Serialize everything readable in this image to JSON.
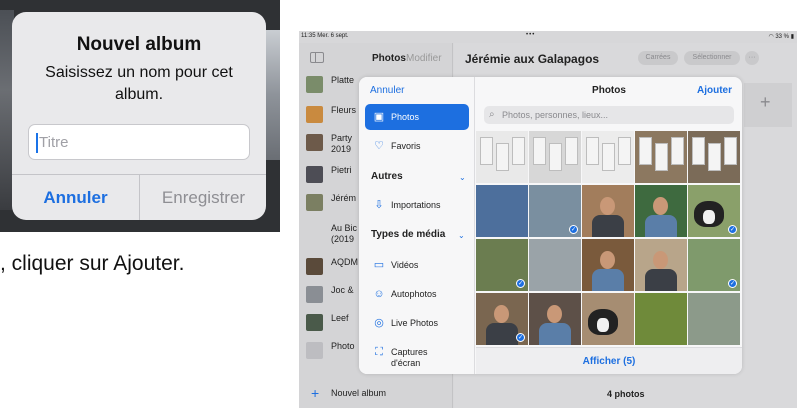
{
  "alert": {
    "title": "Nouvel album",
    "message": "Saisissez un nom pour cet album.",
    "input_placeholder": "Titre",
    "input_value": "",
    "cancel_label": "Annuler",
    "save_label": "Enregistrer",
    "accent_color": "#1d6fe0"
  },
  "instruction_text": ", cliquer sur Ajouter.",
  "ipad": {
    "status": {
      "time": "11:35  Mer. 6 sept.",
      "dots": "•••",
      "battery": "33 %"
    },
    "sidebar": {
      "title": "Photos",
      "edit_label": "Modifier",
      "albums": [
        {
          "label": "Platte",
          "thumb_color": "#7a8c6a"
        },
        {
          "label": "Fleurs",
          "thumb_color": "#c98a3f"
        },
        {
          "label": "Party\n2019",
          "thumb_color": "#6d5a4a"
        },
        {
          "label": "Pietri",
          "thumb_color": "#4d4d55"
        },
        {
          "label": "Jérém",
          "thumb_color": "#7b7f62"
        },
        {
          "label": "Au Bic\n(2019",
          "thumb_color": "#d4d4d6"
        },
        {
          "label": "AQDM",
          "thumb_color": "#5a4a3a"
        },
        {
          "label": "Joc &",
          "thumb_color": "#8a8e94"
        },
        {
          "label": "Leef",
          "thumb_color": "#4a5a4a"
        },
        {
          "label": "Photo",
          "thumb_color": "#bdbdc1"
        }
      ],
      "new_album_label": "Nouvel album"
    },
    "main": {
      "album_title": "Jérémie aux Galapagos",
      "btn_cards": "Carrées",
      "btn_select": "Sélectionner",
      "btn_more": "···",
      "photo_count": "4 photos"
    },
    "picker": {
      "cancel_label": "Annuler",
      "title": "Photos",
      "add_label": "Ajouter",
      "search_placeholder": "Photos, personnes, lieux...",
      "sources": [
        {
          "label": "Photos",
          "icon": "photos-icon",
          "glyph": "▣",
          "active": true
        },
        {
          "label": "Favoris",
          "icon": "heart-icon",
          "glyph": "♡",
          "active": false
        }
      ],
      "section_others": "Autres",
      "others": [
        {
          "label": "Importations",
          "icon": "import-icon",
          "glyph": "⇩"
        }
      ],
      "section_media": "Types de média",
      "media": [
        {
          "label": "Vidéos",
          "icon": "video-icon",
          "glyph": "▭"
        },
        {
          "label": "Autophotos",
          "icon": "selfie-icon",
          "glyph": "☺"
        },
        {
          "label": "Live Photos",
          "icon": "live-photo-icon",
          "glyph": "◎"
        },
        {
          "label": "Captures\nd'écran",
          "icon": "screenshot-icon",
          "glyph": "⛶"
        }
      ],
      "show_label": "Afficher (5)"
    }
  }
}
